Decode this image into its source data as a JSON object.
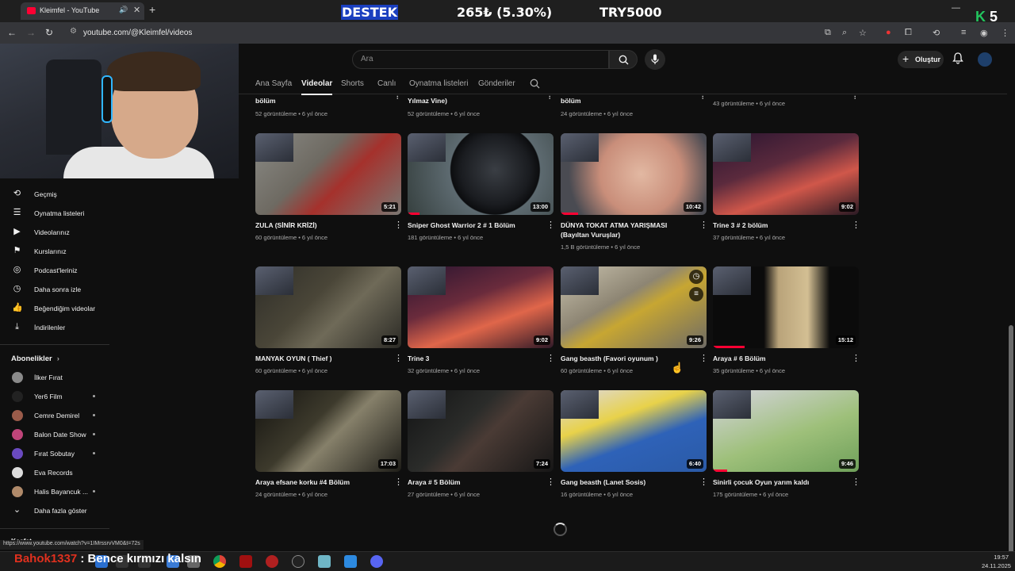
{
  "browser": {
    "tab_title": "Kleimfel - YouTube",
    "url": "youtube.com/@Kleimfel/videos",
    "status_url": "https://www.youtube.com/watch?v=1IMrssrvVM0&t=72s"
  },
  "overlay": {
    "donation_label": "DESTEK",
    "donation_amount": "265₺ (5.30%)",
    "donation_goal": "TRY5000",
    "badge_letter": "K",
    "badge_number": "5",
    "chat_user": "Bahok1337",
    "chat_message": ": Bence kırmızı kalsın"
  },
  "youtube": {
    "search_placeholder": "Ara",
    "create_label": "Oluştur",
    "channel_tabs": [
      "Ana Sayfa",
      "Videolar",
      "Shorts",
      "Canlı",
      "Oynatma listeleri",
      "Gönderiler"
    ],
    "active_tab": "Videolar"
  },
  "sidebar": {
    "you_items": [
      {
        "label": "Geçmiş",
        "icon": "history-icon"
      },
      {
        "label": "Oynatma listeleri",
        "icon": "playlist-icon"
      },
      {
        "label": "Videolarınız",
        "icon": "your-videos-icon"
      },
      {
        "label": "Kurslarınız",
        "icon": "courses-icon"
      },
      {
        "label": "Podcast'leriniz",
        "icon": "podcast-icon"
      },
      {
        "label": "Daha sonra izle",
        "icon": "watch-later-icon"
      },
      {
        "label": "Beğendiğim videolar",
        "icon": "like-icon"
      },
      {
        "label": "İndirilenler",
        "icon": "download-icon"
      }
    ],
    "subs_header": "Abonelikler",
    "subscriptions": [
      {
        "name": "İlker Fırat",
        "color": "#8a8a8a",
        "live": false
      },
      {
        "name": "Yer6 Film",
        "color": "#222222",
        "live": true
      },
      {
        "name": "Cemre Demirel",
        "color": "#9a5b4a",
        "live": true
      },
      {
        "name": "Balon Date Show",
        "color": "#c0457a",
        "live": true
      },
      {
        "name": "Fırat Sobutay",
        "color": "#6a4ac0",
        "live": true
      },
      {
        "name": "Eva Records",
        "color": "#dddddd",
        "live": false
      },
      {
        "name": "Halis Bayancuk ...",
        "color": "#b08a6a",
        "live": true
      }
    ],
    "show_more": "Daha fazla göster",
    "explore": "Keşfet"
  },
  "top_partial_row": [
    {
      "title": "bölüm",
      "meta": "52 görüntüleme • 6 yıl önce"
    },
    {
      "title": "Yılmaz Vine)",
      "meta": "52 görüntüleme • 6 yıl önce"
    },
    {
      "title": "bölüm",
      "meta": "24 görüntüleme • 6 yıl önce"
    },
    {
      "title": "",
      "meta": "43 görüntüleme • 6 yıl önce"
    }
  ],
  "videos": [
    {
      "title": "ZULA (SİNİR KRİZİ)",
      "meta": "60 görüntüleme • 6 yıl önce",
      "duration": "5:21",
      "bg": "linear-gradient(135deg,#8b8b86 0%,#6e6a62 40%,#a5312c 60%,#7a7772 100%)",
      "progress": 0
    },
    {
      "title": "Sniper Ghost Warrior 2 # 1 Bölüm",
      "meta": "181 görüntüleme • 6 yıl önce",
      "duration": "13:00",
      "bg": "radial-gradient(circle at 60% 45%,#3a3e44 0%,#1a1c20 35%,#0c0d0f 45%,#5d6a70 46%,#36403f 100%)",
      "progress": 0.08
    },
    {
      "title": "DÜNYA TOKAT ATMA YARIŞMASI (Bayıltan Vuruşlar)",
      "meta": "1,5 B görüntüleme • 6 yıl önce",
      "duration": "10:42",
      "bg": "radial-gradient(circle at 55% 50%,#e2b8a2 0%,#c98e7a 45%,#4a4b52 80%)",
      "progress": 0.12
    },
    {
      "title": "Trine 3 # 2 bölüm",
      "meta": "37 görüntüleme • 6 yıl önce",
      "duration": "9:02",
      "bg": "linear-gradient(160deg,#2a1530 0%,#5b2a3d 40%,#d0574a 65%,#2a1a24 100%)",
      "progress": 0
    },
    {
      "title": "MANYAK OYUN ( Thief )",
      "meta": "60 görüntüleme • 6 yıl önce",
      "duration": "8:27",
      "bg": "linear-gradient(135deg,#2e2d28 0%,#4a4638 40%,#6f6a58 60%,#2b2a25 100%)",
      "progress": 0
    },
    {
      "title": "Trine 3",
      "meta": "32 görüntüleme • 6 yıl önce",
      "duration": "9:02",
      "bg": "linear-gradient(160deg,#2a1530 0%,#6a2b3c 40%,#e0664a 65%,#301a28 100%)",
      "progress": 0
    },
    {
      "title": "Gang beasth (Favori oyunum )",
      "meta": "60 görüntüleme • 6 yıl önce",
      "duration": "9:26",
      "bg": "linear-gradient(150deg,#c9c2ae 0%,#8d8573 40%,#c7a632 55%,#6e6b66 100%)",
      "progress": 0
    },
    {
      "title": "Araya # 6 Bölüm",
      "meta": "35 görüntüleme • 6 yıl önce",
      "duration": "15:12",
      "bg": "linear-gradient(90deg,#0b0b0b 0%,#0b0b0b 35%,#b9a37a 45%,#d3bf93 65%,#0b0b0b 80%)",
      "progress": 0.22
    },
    {
      "title": "Araya efsane korku #4 Bölüm",
      "meta": "24 görüntüleme • 6 yıl önce",
      "duration": "17:03",
      "bg": "linear-gradient(135deg,#141310 0%,#3d3a2c 40%,#86806a 55%,#1e1d18 100%)",
      "progress": 0
    },
    {
      "title": "Araya # 5 Bölüm",
      "meta": "27 görüntüleme • 6 yıl önce",
      "duration": "7:24",
      "bg": "linear-gradient(135deg,#121314 0%,#2b2c2a 40%,#4a3b35 55%,#161616 100%)",
      "progress": 0
    },
    {
      "title": "Gang beasth (Lanet Sosis)",
      "meta": "16 görüntüleme • 6 yıl önce",
      "duration": "6:40",
      "bg": "linear-gradient(160deg,#dcd9e6 0%,#e8d24a 35%,#2e62b8 60%,#2b5aa6 100%)",
      "progress": 0
    },
    {
      "title": "Sinirli çocuk Oyun yarım kaldı",
      "meta": "175 görüntüleme • 6 yıl önce",
      "duration": "9:46",
      "bg": "linear-gradient(160deg,#d6d4e0 0%,#9ec07a 55%,#6fa05a 100%)",
      "progress": 0.1
    }
  ],
  "hover_card_index": 6,
  "taskbar": {
    "time": "19:57",
    "date": "24.11.2025"
  }
}
